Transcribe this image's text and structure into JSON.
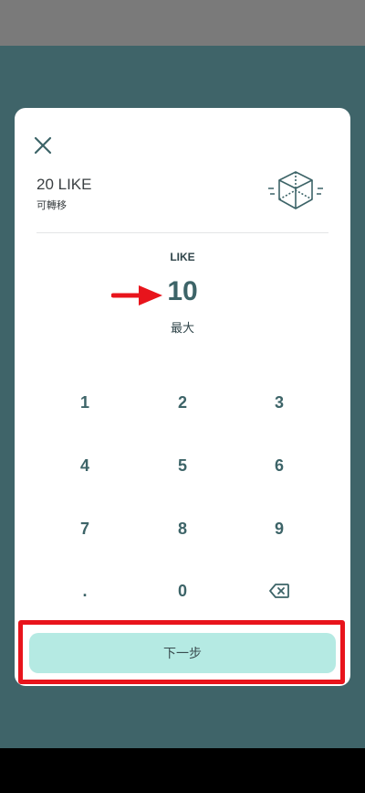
{
  "dialog": {
    "title_amount": "20 LIKE",
    "title_sub": "可轉移",
    "unit_label": "LIKE",
    "amount_value": "10",
    "max_label": "最大"
  },
  "keypad": {
    "keys": [
      "1",
      "2",
      "3",
      "4",
      "5",
      "6",
      "7",
      "8",
      "9",
      ".",
      "0"
    ]
  },
  "actions": {
    "next_label": "下一步"
  },
  "icons": {
    "close": "close-icon",
    "cube": "cube-icon",
    "backspace": "backspace-icon",
    "annotation_arrow": "red-arrow-annotation"
  },
  "colors": {
    "backdrop": "#3f6469",
    "accent_text": "#3d6468",
    "next_button": "#b5eae3",
    "annotation": "#e8141c"
  }
}
